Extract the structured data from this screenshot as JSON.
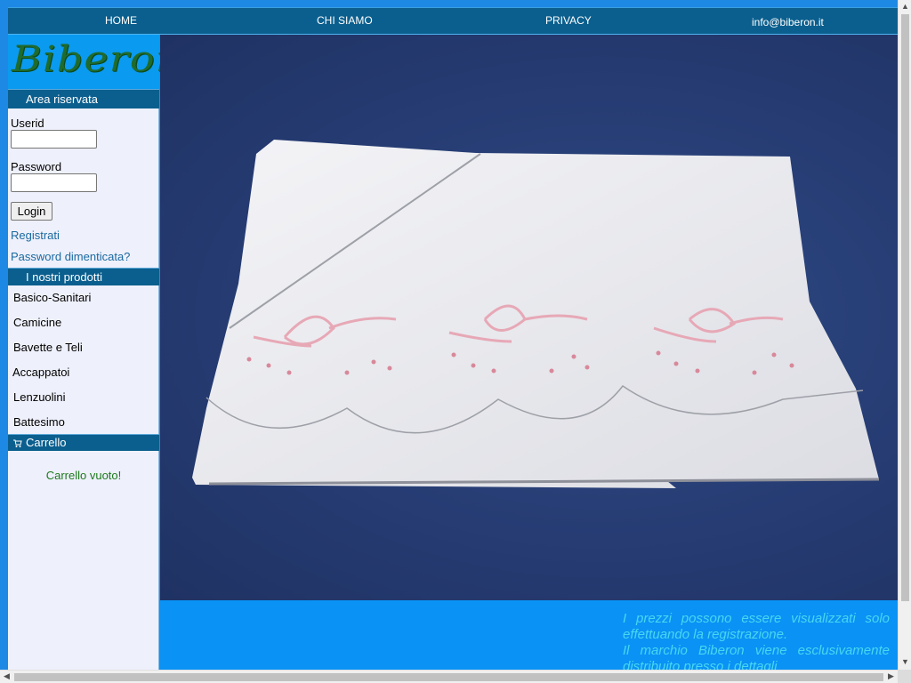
{
  "nav": {
    "home": "HOME",
    "about": "CHI SIAMO",
    "privacy": "PRIVACY",
    "email": "info@biberon.it"
  },
  "sidebar": {
    "logo_text": "Biberon",
    "reserved_area_title": "Area riservata",
    "userid_label": "Userid",
    "userid_value": "",
    "password_label": "Password",
    "password_value": "",
    "login_label": "Login",
    "register_link": "Registrati",
    "forgot_link": "Password dimenticata?",
    "products_title": "I nostri prodotti",
    "products": [
      "Basico-Sanitari",
      "Camicine",
      "Bavette e Teli",
      "Accappatoi",
      "Lenzuolini",
      "Battesimo"
    ],
    "cart_title": "Carrello",
    "cart_empty": "Carrello vuoto!"
  },
  "footer": {
    "line1": "I prezzi possono essere visualizzati solo",
    "line2": "effettuando la registrazione.",
    "line3": "Il marchio Biberon viene esclusivamente",
    "line4": "distribuito presso i dettagli"
  },
  "colors": {
    "nav_bg": "#0b5f8e",
    "frame_blue": "#1e88e5",
    "footer_bg": "#0a92f5",
    "footer_text": "#48d7f0",
    "cart_empty_text": "#1d7a1d",
    "link": "#1a6aa0"
  },
  "icons": {
    "cart": "shopping-cart-icon",
    "scroll_up": "arrow-up-icon",
    "scroll_down": "arrow-down-icon",
    "scroll_left": "arrow-left-icon",
    "scroll_right": "arrow-right-icon"
  }
}
